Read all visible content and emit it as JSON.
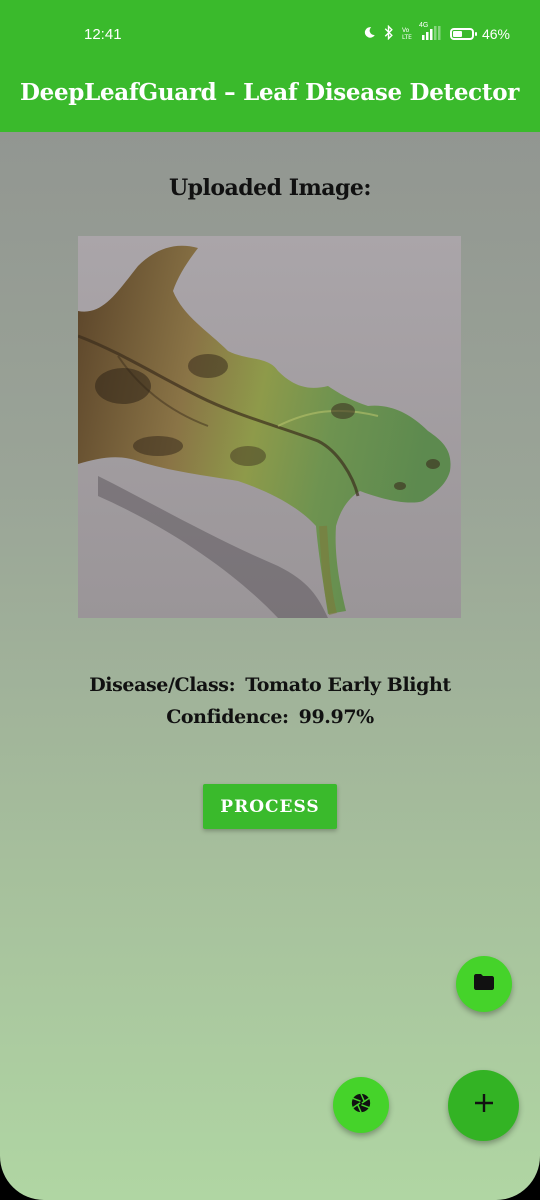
{
  "status_bar": {
    "time": "12:41",
    "network_label": "4G",
    "battery_percent": "46%"
  },
  "app_bar": {
    "title": "DeepLeafGuard – Leaf Disease Detector",
    "color": "#3aba2c"
  },
  "main": {
    "uploaded_heading": "Uploaded Image:",
    "disease_label": "Disease/Class:",
    "disease_value": "Tomato Early Blight",
    "confidence_label": "Confidence:",
    "confidence_value": "99.97%",
    "process_button": "PROCESS"
  },
  "fabs": {
    "folder_icon": "folder-icon",
    "camera_icon": "camera-shutter-icon",
    "add_icon": "plus-icon",
    "color": "#45d32a"
  }
}
